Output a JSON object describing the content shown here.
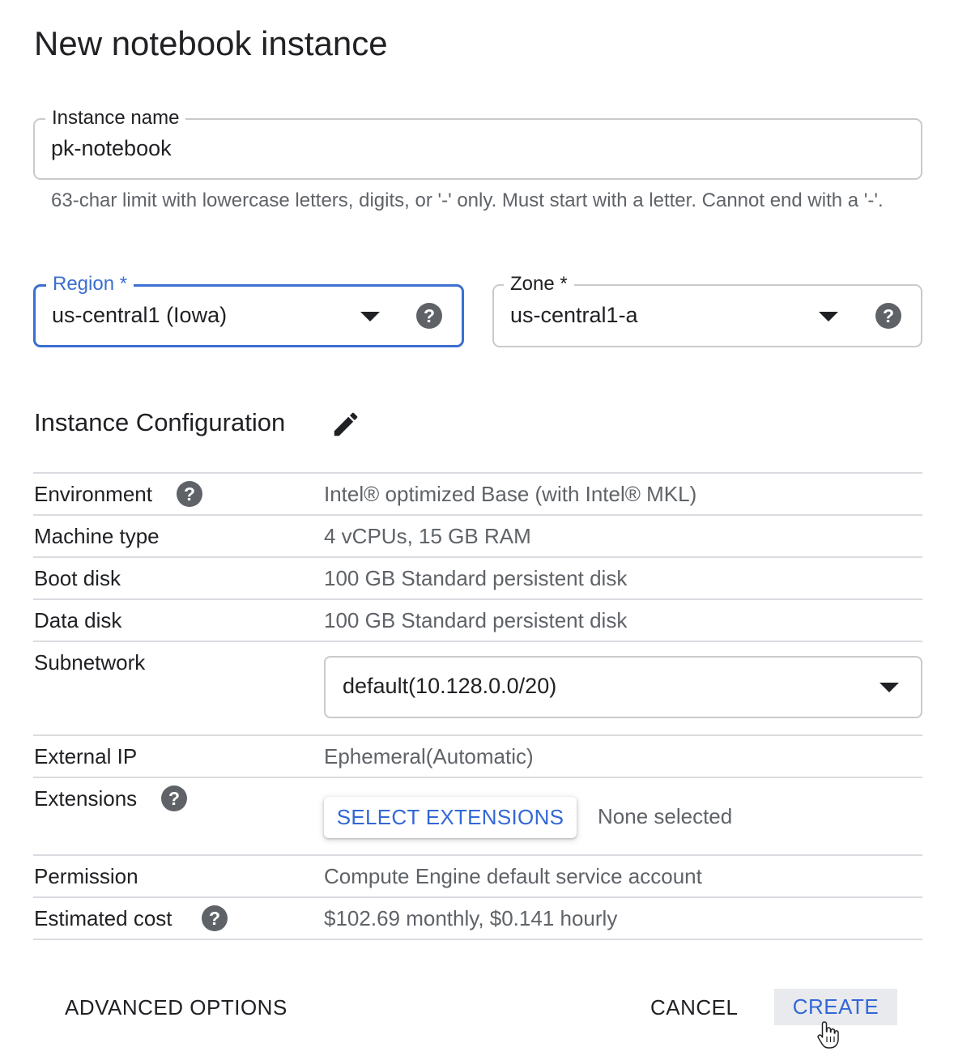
{
  "dialog": {
    "title": "New notebook instance"
  },
  "instance_name": {
    "label": "Instance name",
    "value": "pk-notebook",
    "hint": "63-char limit with lowercase letters, digits, or '-' only. Must start with a letter. Cannot end with a '-'."
  },
  "region": {
    "label": "Region *",
    "value": "us-central1 (Iowa)",
    "focused": true
  },
  "zone": {
    "label": "Zone *",
    "value": "us-central1-a"
  },
  "config": {
    "title": "Instance Configuration",
    "rows": [
      {
        "label": "Environment",
        "value": "Intel® optimized Base (with Intel® MKL)",
        "has_help": true
      },
      {
        "label": "Machine type",
        "value": "4 vCPUs, 15 GB RAM"
      },
      {
        "label": "Boot disk",
        "value": "100 GB Standard persistent disk"
      },
      {
        "label": "Data disk",
        "value": "100 GB Standard persistent disk"
      },
      {
        "label": "Subnetwork",
        "value": "default(10.128.0.0/20)"
      },
      {
        "label": "External IP",
        "value": "Ephemeral(Automatic)"
      },
      {
        "label": "Extensions",
        "button": "SELECT EXTENSIONS",
        "status": "None selected",
        "has_help": true
      },
      {
        "label": "Permission",
        "value": "Compute Engine default service account"
      },
      {
        "label": "Estimated cost",
        "value": "$102.69 monthly, $0.141 hourly",
        "has_help": true
      }
    ]
  },
  "footer": {
    "advanced_label": "ADVANCED OPTIONS",
    "cancel_label": "CANCEL",
    "create_label": "CREATE"
  },
  "colors": {
    "accent": "#3367d6",
    "focus_border": "#3b6fd0",
    "help_icon": "#5f6368",
    "create_hover": "#e8eaed"
  },
  "icons": [
    "help-icon",
    "dropdown-arrow-icon",
    "pencil-icon",
    "hand-cursor-icon"
  ]
}
